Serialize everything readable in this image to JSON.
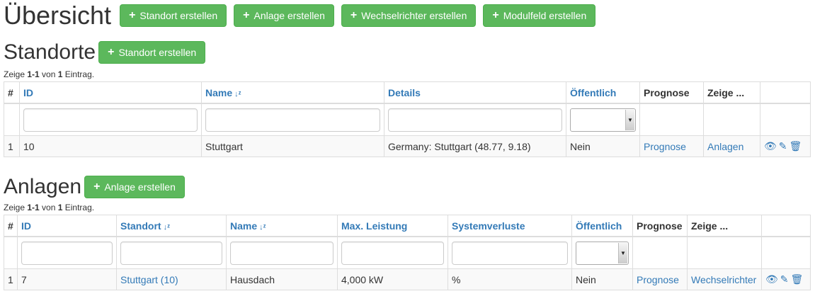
{
  "header": {
    "title": "Übersicht",
    "buttons": [
      "Standort erstellen",
      "Anlage erstellen",
      "Wechselrichter erstellen",
      "Modulfeld erstellen"
    ]
  },
  "standorte": {
    "title": "Standorte",
    "create_label": "Standort erstellen",
    "summary": {
      "prefix": "Zeige ",
      "range": "1-1",
      "mid": " von ",
      "total": "1",
      "suffix": " Eintrag."
    },
    "columns": {
      "num": "#",
      "id": "ID",
      "name": "Name",
      "details": "Details",
      "public": "Öffentlich",
      "forecast": "Prognose",
      "show": "Zeige ..."
    },
    "row": {
      "num": "1",
      "id": "10",
      "name": "Stuttgart",
      "details": "Germany: Stuttgart (48.77, 9.18)",
      "public": "Nein",
      "forecast": "Prognose",
      "show": "Anlagen"
    }
  },
  "anlagen": {
    "title": "Anlagen",
    "create_label": "Anlage erstellen",
    "summary": {
      "prefix": "Zeige ",
      "range": "1-1",
      "mid": " von ",
      "total": "1",
      "suffix": " Eintrag."
    },
    "columns": {
      "num": "#",
      "id": "ID",
      "location": "Standort",
      "name": "Name",
      "power": "Max. Leistung",
      "losses": "Systemverluste",
      "public": "Öffentlich",
      "forecast": "Prognose",
      "show": "Zeige ..."
    },
    "row": {
      "num": "1",
      "id": "7",
      "location": "Stuttgart (10)",
      "name": "Hausdach",
      "power": "4,000 kW",
      "losses": "%",
      "public": "Nein",
      "forecast": "Prognose",
      "show": "Wechselrichter"
    }
  },
  "icons": {
    "view": "eye-icon",
    "edit": "pencil-icon",
    "delete": "trash-icon",
    "sort": "sort-icon",
    "plus": "plus-icon"
  },
  "colors": {
    "button": "#5cb85c",
    "link": "#337ab7"
  }
}
